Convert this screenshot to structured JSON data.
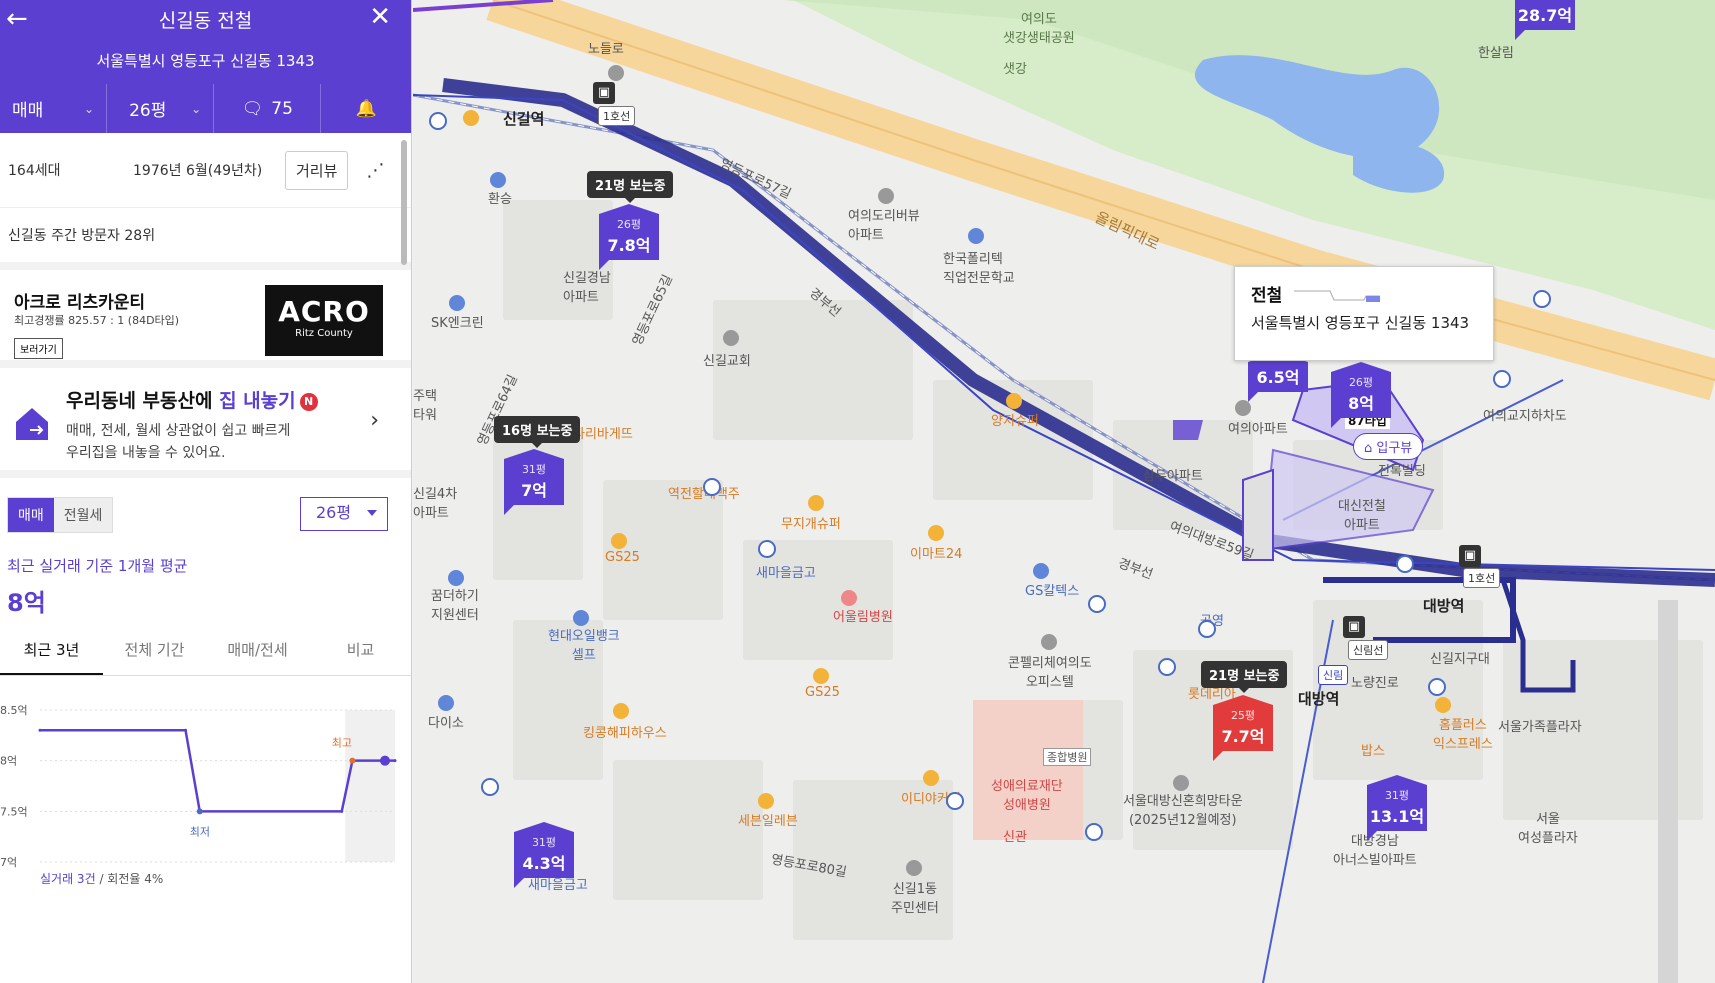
{
  "header": {
    "back_icon": "arrow-left-icon",
    "title": "신길동 전철",
    "close_icon": "close-icon",
    "address": "서울특별시 영등포구 신길동 1343",
    "filters": {
      "deal_type": "매매",
      "size": "26평",
      "comments_count": "75"
    }
  },
  "summary": {
    "households": "164세대",
    "built": "1976년 6월(49년차)",
    "street_view_label": "거리뷰",
    "visitor_rank": "신길동 주간 방문자 28위"
  },
  "ad": {
    "name": "아크로 리츠카운티",
    "competition": "최고경쟁률 825.57 : 1 (84D타입)",
    "button": "보러가기",
    "logo_main": "ACRO",
    "logo_sub": "Ritz County"
  },
  "promo": {
    "title_prefix": "우리동네 부동산에 ",
    "title_highlight": "집 내놓기",
    "badge": "N",
    "desc_line1": "매매, 전세, 월세 상관없이 쉽고 빠르게",
    "desc_line2": "우리집을 내놓을 수 있어요."
  },
  "price_section": {
    "seg_sale": "매매",
    "seg_rent": "전월세",
    "size_select": "26평",
    "avg_label": "최근 실거래 기준 1개월 평균",
    "avg_value": "8억",
    "tabs": [
      "최근 3년",
      "전체 기간",
      "매매/전세",
      "비교"
    ],
    "foot_trades": "실거래 3건",
    "foot_turnover": " / 회전율 4%"
  },
  "chart_data": {
    "type": "line",
    "y_ticks": [
      "8.5억",
      "8억",
      "7.5억",
      "7억"
    ],
    "ylim": [
      7,
      8.5
    ],
    "series": [
      {
        "values": [
          8.3,
          8.3,
          7.5,
          7.5,
          8.0,
          8.0
        ]
      }
    ],
    "x": [
      0,
      0.41,
      0.45,
      0.85,
      0.88,
      1.0
    ],
    "annotations": [
      {
        "label": "최저",
        "value": 7.5
      },
      {
        "label": "최고",
        "value": 8.0
      }
    ],
    "line_color": "#5b3fd0",
    "grid": true
  },
  "map": {
    "labels": {
      "sinkil_station": "신길역",
      "daebang_station": "대방역",
      "line1": "1호선",
      "sinrim_line": "신림선",
      "olympic": "올림픽대로",
      "yeouido_park": "여의도\n샛강생태공원",
      "saetgang": "샛강",
      "hansalim": "한살림",
      "yeouido_apt": "여의도리버뷰\n아파트",
      "skills_school": "한국폴리텍\n직업전문학교",
      "sinkil_church": "신길교회",
      "yangji": "양지슈퍼",
      "yeoui_apt": "여의아파트",
      "samdu_apt": "삼두아파트",
      "entrance_view": "입구뷰",
      "jeonbok": "전록빌딩",
      "daesin_apt": "대신전철\n아파트",
      "paris": "파리바게뜨",
      "nonjeon": "노들로",
      "hwanseung": "환승",
      "sk": "SK엔크린",
      "sinkil_gyeongnam": "신길경남\n아파트",
      "yeongdeungpo_57": "영등포로57길",
      "yeongdeungpo_65": "영등포로65길",
      "yeongdeungpo_64": "영등포로64길",
      "gyeongbu": "경부선",
      "sinkil_5": "신길4차\n아파트",
      "kkumdeo": "꿈더하기\n지원센터",
      "daiso": "다이소",
      "gs25a": "GS25",
      "gs25b": "GS25",
      "hyundai_oil": "현대오일뱅크\n셀프",
      "kinggong": "킹콩해피하우스",
      "mujigae": "무지개슈퍼",
      "emart": "이마트24",
      "saemaeul1": "새마을금고",
      "saemaeul2": "새마을금고",
      "eoullim": "어울림병원",
      "gs_caltex": "GS칼텍스",
      "concelli": "콘펠리체여의도\n오피스텔",
      "general_hosp": "종합병원",
      "sungae": "성애의료재단\n성애병원",
      "sinkwan": "신관",
      "idiya": "이디야커피",
      "seven": "세븐일레븐",
      "lotteria": "롯데리아",
      "sinhon": "서울대방신혼희망타운\n(2025년12월예정)",
      "daebang_apt": "대방경남\n아너스빌아파트",
      "homeplus": "홈플러스\n익스프레스",
      "sinkil_jigu": "신길지구대",
      "seoul_family": "서울가족플라자",
      "women_plaza": "서울\n여성플라자",
      "daehangno": "노량진로",
      "yeouidaebang59": "여의대방로59길",
      "yeouigyo": "여의교지하차도",
      "gongyeong": "공영",
      "sinkil1": "신길1동\n주민센터",
      "yeongdeungpo80": "영등포로80길",
      "sinrim_label": "신림",
      "baps": "밥스",
      "jiyeok_gonggan": "역전할매맥주",
      "jutaek_tower": "주택\n타워"
    },
    "watch_badges": [
      "21명 보는중",
      "16명 보는중",
      "21명 보는중"
    ],
    "markers": [
      {
        "py": "26평",
        "price": "7.8억"
      },
      {
        "py": "31평",
        "price": "7억"
      },
      {
        "py": "31평",
        "price": "4.3억"
      },
      {
        "py": "25평",
        "price": "7.7억"
      },
      {
        "py": "26평",
        "price": "8억"
      },
      {
        "py": "",
        "price": "6.5억"
      },
      {
        "py": "31평",
        "price": "13.1억"
      },
      {
        "py": "",
        "price": "28.7억"
      }
    ],
    "type_tag": "87타입",
    "tooltip": {
      "title": "전철",
      "address": "서울특별시 영등포구 신길동 1343"
    },
    "colors": {
      "brand": "#5b3fd0",
      "red_marker": "#e23b3b",
      "line1_blue": "#2b2e8f"
    }
  }
}
